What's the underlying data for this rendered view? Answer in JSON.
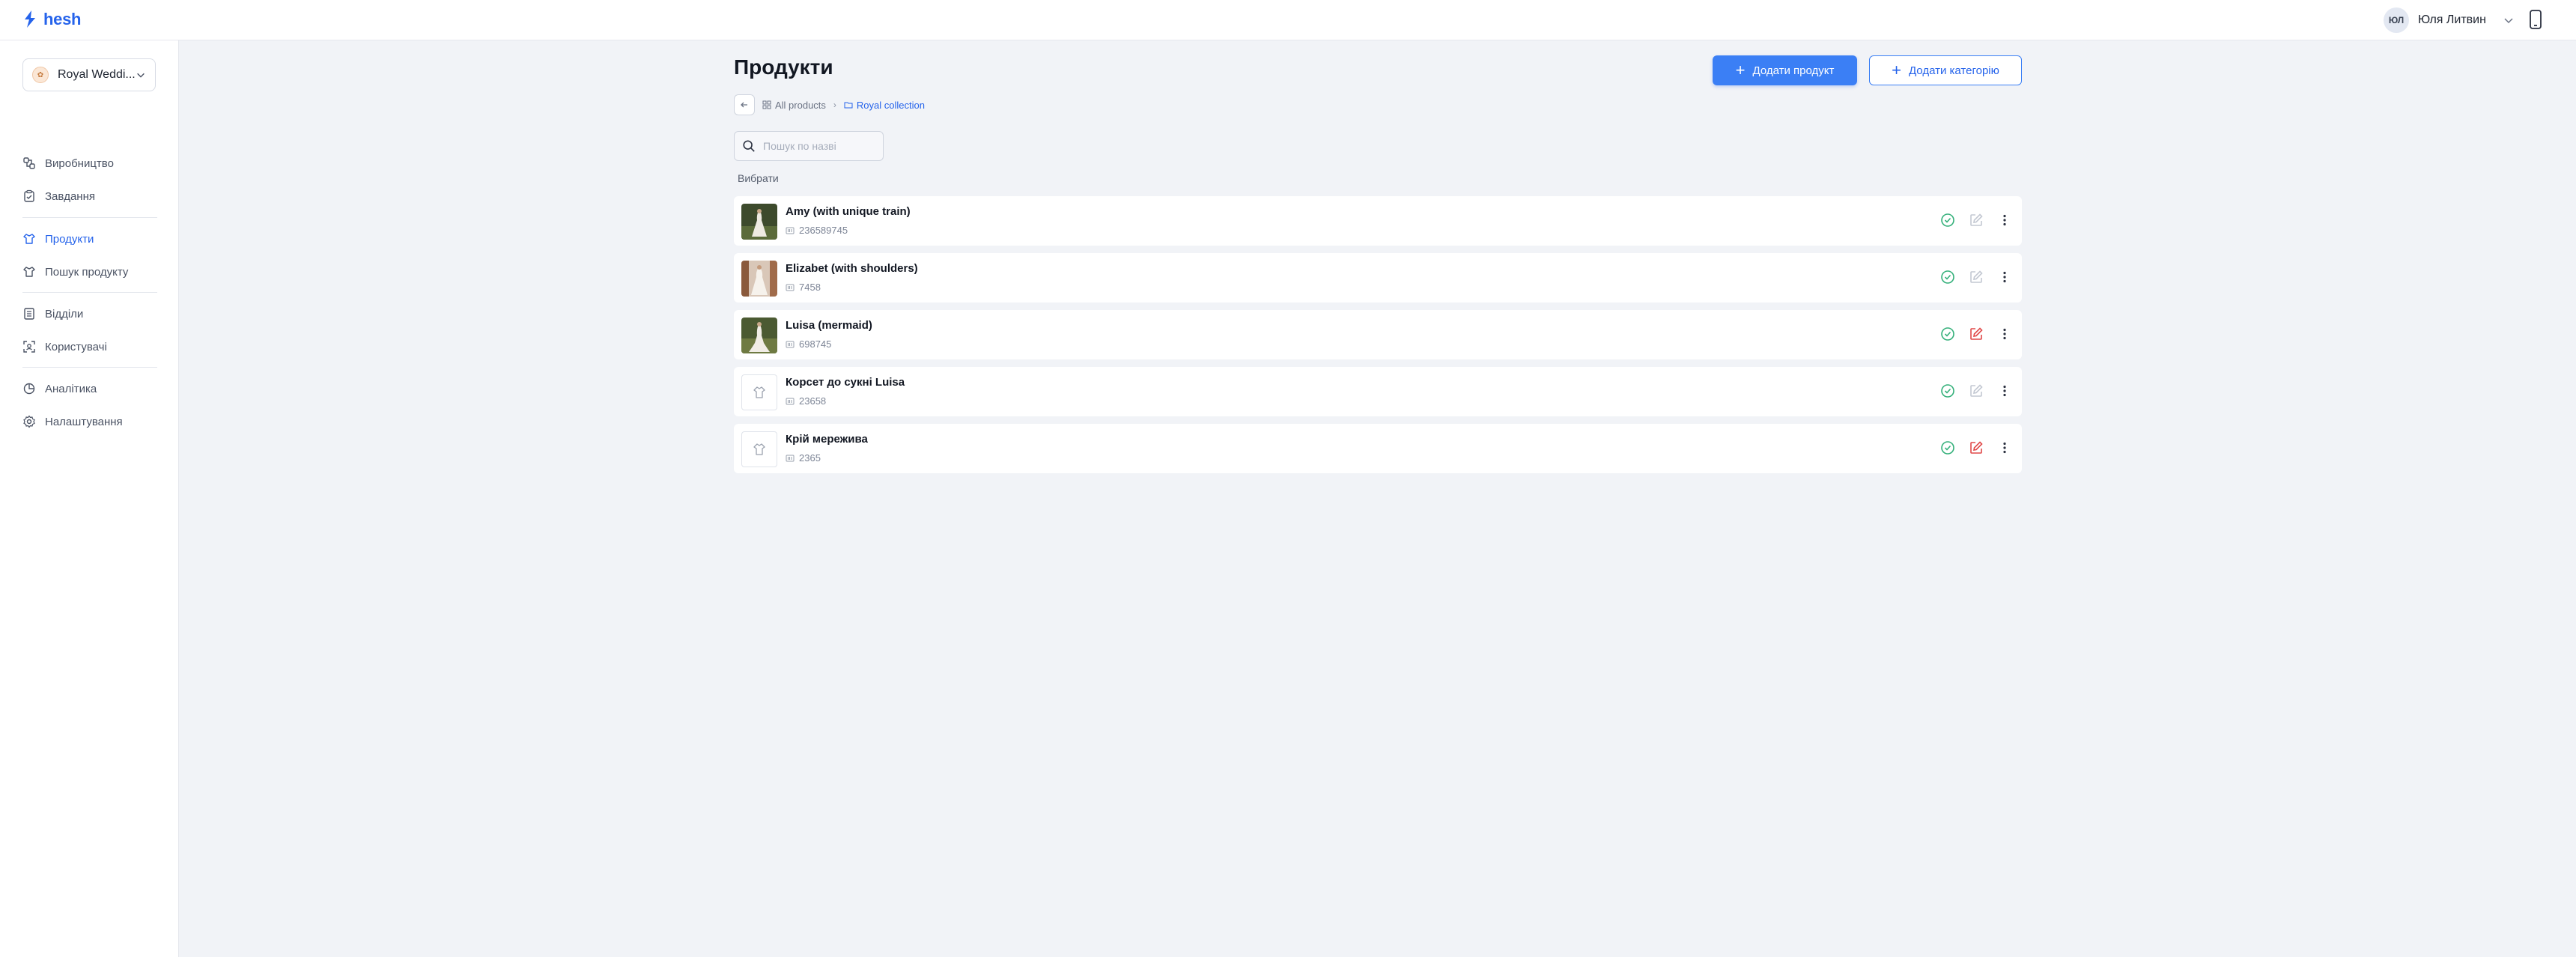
{
  "app": {
    "logo_text": "hesh"
  },
  "user": {
    "initials": "ЮЛ",
    "name": "Юля Литвин"
  },
  "sidebar": {
    "company": "Royal Weddi...",
    "items": [
      {
        "label": "Виробництво",
        "icon": "production-icon"
      },
      {
        "label": "Завдання",
        "icon": "tasks-icon"
      },
      {
        "label": "Продукти",
        "icon": "products-icon",
        "active": true
      },
      {
        "label": "Пошук продукту",
        "icon": "product-search-icon"
      },
      {
        "label": "Відділи",
        "icon": "departments-icon"
      },
      {
        "label": "Користувачі",
        "icon": "users-icon"
      },
      {
        "label": "Аналітика",
        "icon": "analytics-icon"
      },
      {
        "label": "Налаштування",
        "icon": "settings-icon"
      }
    ]
  },
  "main": {
    "title": "Продукти",
    "add_product_label": "Додати продукт",
    "add_category_label": "Додати категорію",
    "breadcrumb": {
      "root": "All products",
      "current": "Royal collection"
    },
    "search_placeholder": "Пошук по назві",
    "section_label": "Вибрати"
  },
  "products": [
    {
      "name": "Amy (with unique train)",
      "code": "236589745",
      "has_image": true,
      "edit_status": "inactive"
    },
    {
      "name": "Elizabet (with shoulders)",
      "code": "7458",
      "has_image": true,
      "edit_status": "inactive"
    },
    {
      "name": "Luisa (mermaid)",
      "code": "698745",
      "has_image": true,
      "edit_status": "active"
    },
    {
      "name": "Корсет до сукні Luisa",
      "code": "23658",
      "has_image": false,
      "edit_status": "inactive"
    },
    {
      "name": "Крій мережива",
      "code": "2365",
      "has_image": false,
      "edit_status": "active"
    }
  ],
  "colors": {
    "accent": "#3b7ff5",
    "check": "#34b07a",
    "edit_active": "#e04848",
    "edit_inactive": "#c3c8d2"
  }
}
